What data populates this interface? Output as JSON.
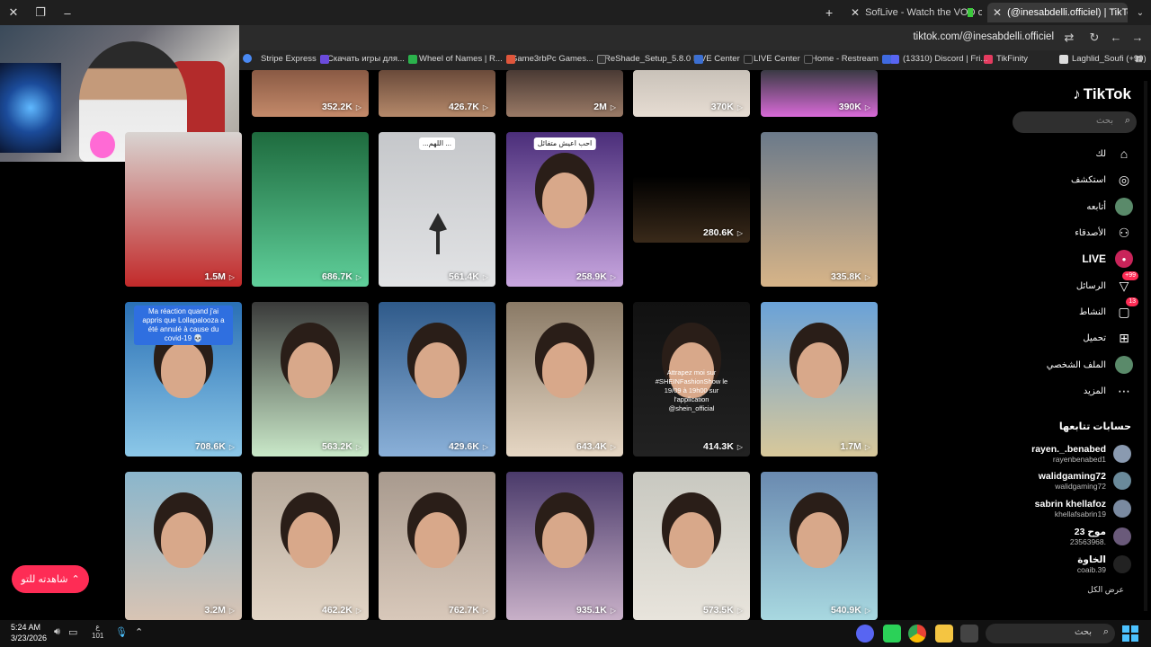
{
  "browser": {
    "tabs": [
      {
        "title": "SofLive - Watch the VOD on Ki",
        "active": false
      },
      {
        "title": "(@inesabdelli.officiel) | TikTok",
        "active": true
      }
    ],
    "url": "tiktok.com/@inesabdelli.officiel",
    "bookmarks": [
      "Stripe Express",
      "Скачать игры для...",
      "Wheel of Names | R...",
      "Game3rbPc Games...",
      "ReShade_Setup_5.8.0",
      "LIVE Center",
      "LIVE Center",
      "Home - Restream",
      "(13310) Discord | Fri...",
      "TikFinity",
      "Laghlid_Soufi (+99)"
    ]
  },
  "app": {
    "logo": "TikTok",
    "search_placeholder": "بحث",
    "nav": [
      {
        "label": "لك",
        "icon": "home-icon"
      },
      {
        "label": "استكشف",
        "icon": "compass-icon"
      },
      {
        "label": "أتابعه",
        "icon": "following-avatar-icon"
      },
      {
        "label": "الأصدقاء",
        "icon": "friends-icon"
      },
      {
        "label": "LIVE",
        "icon": "live-icon"
      },
      {
        "label": "الرسائل",
        "icon": "messages-icon",
        "badge": "+99"
      },
      {
        "label": "النشاط",
        "icon": "activity-icon",
        "badge": "13"
      },
      {
        "label": "تحميل",
        "icon": "upload-icon"
      },
      {
        "label": "الملف الشخصي",
        "icon": "profile-avatar-icon"
      },
      {
        "label": "المزيد",
        "icon": "more-icon"
      }
    ],
    "following_title": "حسابات تتابعها",
    "following": [
      {
        "name": "rayen._.benabed",
        "handle": "rayenbenabed1"
      },
      {
        "name": "walidgaming72",
        "handle": "walidgaming72"
      },
      {
        "name": "sabrin khellafoz",
        "handle": "khellafsabrin19"
      },
      {
        "name": "موح 23",
        "handle": "23563968."
      },
      {
        "name": "الخاوة",
        "handle": "coaib.39"
      }
    ],
    "see_all": "عرض الكل",
    "watch_button": "شاهدته للتو"
  },
  "videos": [
    {
      "views": "352.2K"
    },
    {
      "views": "426.7K"
    },
    {
      "views": "2M"
    },
    {
      "views": "370K"
    },
    {
      "views": "390K"
    },
    {
      "views": "1.5M"
    },
    {
      "views": "686.7K"
    },
    {
      "views": "561.4K",
      "caption": "...اللهم ..."
    },
    {
      "views": "258.9K",
      "caption": "احب اعيش متفائل"
    },
    {
      "views": "280.6K"
    },
    {
      "views": "335.8K"
    },
    {
      "views": "708.6K",
      "caption": "Ma réaction quand j'ai appris que Lollapalooza a été annulé à cause du covid-19 💀"
    },
    {
      "views": "563.2K"
    },
    {
      "views": "429.6K"
    },
    {
      "views": "643.4K"
    },
    {
      "views": "414.3K",
      "caption": "Attrapez moi sur #SHEINFashionShow le 19/09 à 19h00 sur l'application @shein_official"
    },
    {
      "views": "1.7M"
    },
    {
      "views": "3.2M"
    },
    {
      "views": "462.2K"
    },
    {
      "views": "762.7K"
    },
    {
      "views": "935.1K"
    },
    {
      "views": "573.5K"
    },
    {
      "views": "540.9K"
    }
  ],
  "taskbar": {
    "time": "5:24 AM",
    "date": "3/23/2026",
    "lang": "ع",
    "lang_sub": "101",
    "search_placeholder": "بحث"
  }
}
